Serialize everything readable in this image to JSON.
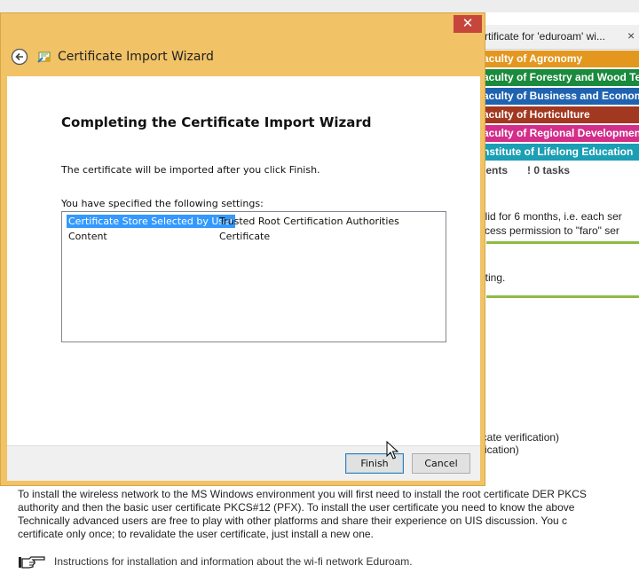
{
  "background_page": {
    "tab_title": "rtificate for 'eduroam' wi...",
    "tab_close": "×",
    "faculties": [
      {
        "label": "aculty of Agronomy",
        "color": "#e3971f"
      },
      {
        "label": "aculty of Forestry and Wood Tech",
        "color": "#1a8a3d"
      },
      {
        "label": "aculty of Business and Economic",
        "color": "#1f63b0"
      },
      {
        "label": "aculty of Horticulture",
        "color": "#a33820"
      },
      {
        "label": "aculty of Regional Development a",
        "color": "#d22e8a"
      },
      {
        "label": "nstitute of Lifelong Education",
        "color": "#1b9fb4"
      }
    ],
    "tasks": {
      "left": "nents",
      "right": "! 0 tasks"
    },
    "partial_lines": [
      "alid for 6 months, i.e. each ser",
      "ccess permission to \"faro\" ser",
      "ating.",
      "icate verification)",
      "ification)"
    ],
    "paragraph_lines": [
      "To install the wireless network to the MS Windows environment you will first need to install the root certificate DER PKCS",
      "authority and then the basic user certificate PKCS#12 (PFX). To install the user certificate you need to know the above",
      "Technically advanced users are free to play with other platforms and share their experience on UIS discussion. You c",
      "certificate only once; to revalidate the user certificate, just install a new one."
    ],
    "instructions_link": "Instructions for installation and information about the wi-fi network Eduroam."
  },
  "dialog": {
    "title": "Certificate Import Wizard",
    "close_label": "✕",
    "back_icon": "back-arrow-icon",
    "wizard_icon": "certificate-icon",
    "heading": "Completing the Certificate Import Wizard",
    "info_text": "The certificate will be imported after you click Finish.",
    "settings_label": "You have specified the following settings:",
    "settings": [
      {
        "key": "Certificate Store Selected by User",
        "value": "Trusted Root Certification Authorities",
        "selected": true
      },
      {
        "key": "Content",
        "value": "Certificate",
        "selected": false
      }
    ],
    "finish_label": "Finish",
    "cancel_label": "Cancel"
  },
  "colors": {
    "dialog_frame": "#f1c266",
    "close_button": "#c7463b",
    "selection": "#3399ff",
    "green_divider": "#8dbb45"
  }
}
